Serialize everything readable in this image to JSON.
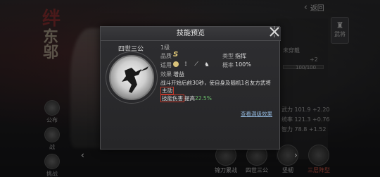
{
  "background": {
    "top_back_label": "返回",
    "calligraphy": "东邬",
    "red_glyph": "绊",
    "left_rail": [
      {
        "label": "公布"
      },
      {
        "label": "战"
      },
      {
        "label": "挑战"
      }
    ],
    "right_tab_label": "武将",
    "right_panel": {
      "line1": "未穿戴",
      "line2": "+2",
      "line3": "100/100",
      "stat1": "武力 101.9 +2.20",
      "stat2": "统率 121.3 +0.76",
      "stat3": "智力 78.8 +1.52"
    },
    "bottom_slots": [
      {
        "label": "锦刀累战"
      },
      {
        "label": "四世三公"
      },
      {
        "label": "坚韧"
      },
      {
        "label": "三层阵型"
      }
    ]
  },
  "modal": {
    "title": "技能预览",
    "skill_name": "四世三公",
    "level": "1级",
    "quality_label": "品质",
    "quality_value": "S",
    "type_label": "类型",
    "type_value": "指挥",
    "apply_label": "适用",
    "rate_label": "概率",
    "rate_value": "100%",
    "effect_label": "效果",
    "effect_value": "增益",
    "desc_part1": "战斗开始后前30秒，使自身及随机1名友方武将",
    "desc_highlight1": "主动",
    "desc_highlight2": "技能伤害",
    "desc_part2": "提高",
    "desc_value": "22.5%",
    "view_more": "查看满级效果"
  },
  "icons": {
    "close": "close-x-icon",
    "apply": [
      "shield-icon",
      "bow-icon",
      "spear-icon",
      "horse-icon"
    ]
  }
}
